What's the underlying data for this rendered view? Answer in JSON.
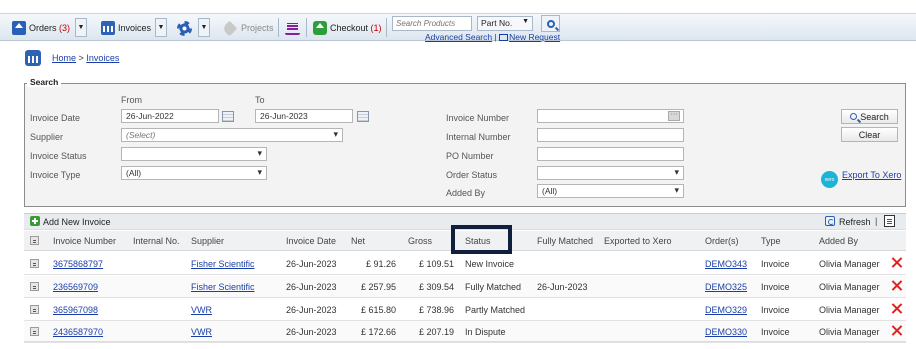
{
  "toolbar": {
    "orders_label": "Orders",
    "orders_count": "(3)",
    "invoices_label": "Invoices",
    "projects_label": "Projects",
    "checkout_label": "Checkout",
    "checkout_count": "(1)",
    "search_placeholder": "Search Products",
    "search_type": "Part No.",
    "advanced_search": "Advanced Search",
    "separator": "|",
    "new_request": "New Request"
  },
  "breadcrumb": {
    "home": "Home",
    "sep": ">",
    "current": "Invoices"
  },
  "search": {
    "legend": "Search",
    "from_label": "From",
    "to_label": "To",
    "invoice_date_label": "Invoice Date",
    "invoice_date_from": "26-Jun-2022",
    "invoice_date_to": "26-Jun-2023",
    "supplier_label": "Supplier",
    "supplier_value": "(Select)",
    "invoice_status_label": "Invoice Status",
    "invoice_status_value": "",
    "invoice_type_label": "Invoice Type",
    "invoice_type_value": "(All)",
    "invoice_number_label": "Invoice Number",
    "invoice_number_value": "",
    "internal_number_label": "Internal Number",
    "internal_number_value": "",
    "po_number_label": "PO Number",
    "po_number_value": "",
    "order_status_label": "Order Status",
    "order_status_value": "",
    "added_by_label": "Added By",
    "added_by_value": "(All)",
    "search_button": "Search",
    "clear_button": "Clear",
    "xero_logo_text": "xero",
    "export_xero": "Export To Xero"
  },
  "grid": {
    "add_invoice": "Add New Invoice",
    "refresh": "Refresh",
    "pipe": "|",
    "columns": [
      "Invoice Number",
      "Internal No.",
      "Supplier",
      "Invoice Date",
      "Net",
      "Gross",
      "Status",
      "Fully Matched",
      "Exported to Xero",
      "Order(s)",
      "Type",
      "Added By"
    ],
    "rows": [
      {
        "invoice_number": "3675868797",
        "internal_no": "",
        "supplier": "Fisher Scientific",
        "invoice_date": "26-Jun-2023",
        "net": "£ 91.26",
        "gross": "£ 109.51",
        "status": "New Invoice",
        "fully_matched": "",
        "exported": "",
        "orders": "DEMO343",
        "type": "Invoice",
        "added_by": "Olivia Manager"
      },
      {
        "invoice_number": "236569709",
        "internal_no": "",
        "supplier": "Fisher Scientific",
        "invoice_date": "26-Jun-2023",
        "net": "£ 257.95",
        "gross": "£ 309.54",
        "status": "Fully Matched",
        "fully_matched": "26-Jun-2023",
        "exported": "",
        "orders": "DEMO325",
        "type": "Invoice",
        "added_by": "Olivia Manager"
      },
      {
        "invoice_number": "365967098",
        "internal_no": "",
        "supplier": "VWR",
        "invoice_date": "26-Jun-2023",
        "net": "£ 615.80",
        "gross": "£ 738.96",
        "status": "Partly Matched",
        "fully_matched": "",
        "exported": "",
        "orders": "DEMO329",
        "type": "Invoice",
        "added_by": "Olivia Manager"
      },
      {
        "invoice_number": "2436587970",
        "internal_no": "",
        "supplier": "VWR",
        "invoice_date": "26-Jun-2023",
        "net": "£ 172.66",
        "gross": "£ 207.19",
        "status": "In Dispute",
        "fully_matched": "",
        "exported": "",
        "orders": "DEMO330",
        "type": "Invoice",
        "added_by": "Olivia Manager"
      }
    ]
  },
  "colors": {
    "accent_blue": "#2a5fb8",
    "link": "#1a3ea8",
    "badge_red": "#c00000",
    "delete_red": "#dd2222",
    "status_highlight": "#0f1f3d"
  }
}
